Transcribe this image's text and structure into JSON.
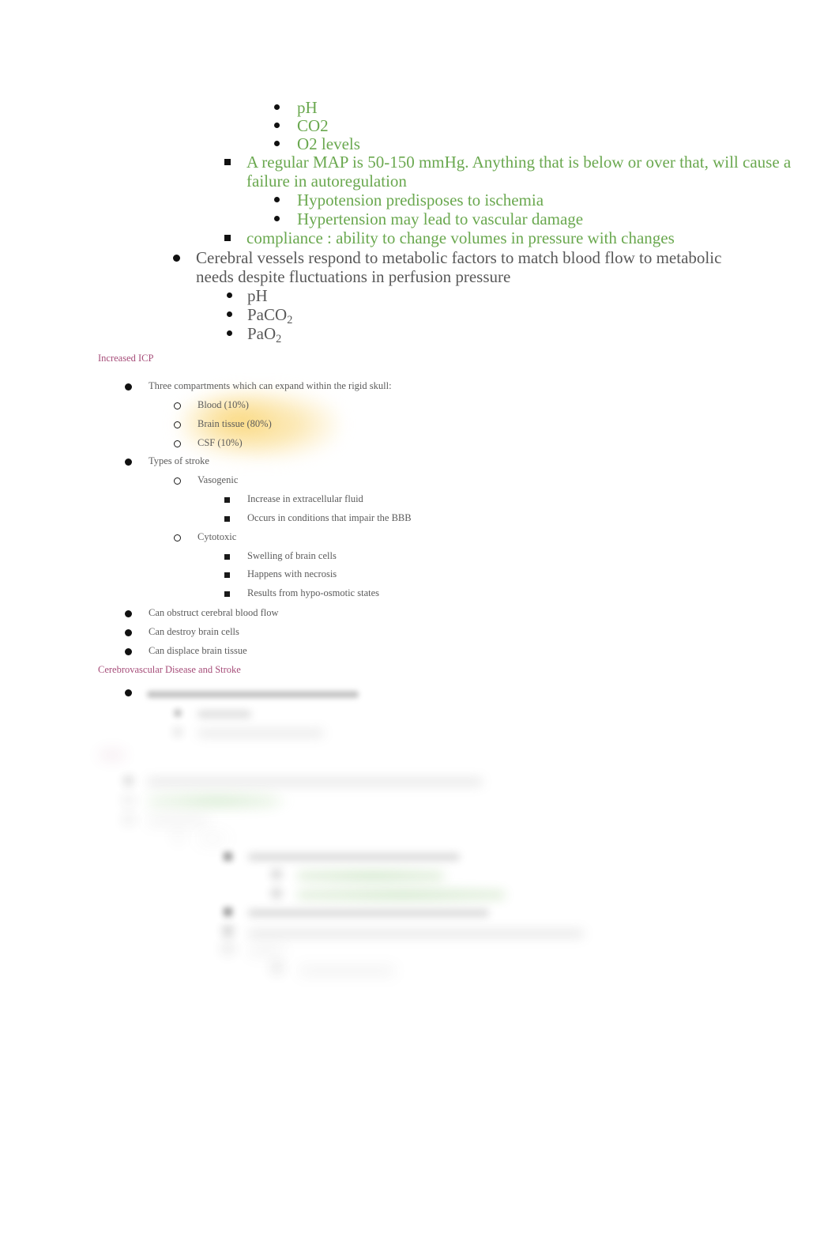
{
  "document": {
    "page_background": "#ffffff",
    "colors": {
      "green_text": "#6aa84f",
      "dark_text": "#595959",
      "heading_magenta": "#a64d79",
      "highlight_yellow": "#fad778",
      "highlight_green": "#96cd8c",
      "bullet_black": "#111111"
    }
  },
  "autoregulation_section": {
    "metabolic_factors": [
      {
        "label": "pH",
        "bullet": "disc-bullet-icon",
        "color": "green"
      },
      {
        "label": "CO2",
        "bullet": "disc-bullet-icon",
        "color": "green"
      },
      {
        "label": "O2 levels",
        "bullet": "disc-bullet-icon",
        "color": "green"
      }
    ],
    "map_statement": {
      "bullet": "square-bullet-icon",
      "color": "green",
      "text": "A regular MAP is 50-150 mmHg. Anything that is below or over that, will cause a failure in autoregulation"
    },
    "map_consequences": [
      {
        "label": "Hypotension predisposes to ischemia",
        "bullet": "disc-bullet-icon",
        "color": "green"
      },
      {
        "label": "Hypertension may lead to vascular damage",
        "bullet": "disc-bullet-icon",
        "color": "green"
      }
    ],
    "compliance": {
      "bullet": "square-bullet-icon",
      "color": "green",
      "text": "compliance : ability to change volumes in pressure with changes"
    },
    "cerebral_vessels": {
      "bullet": "disc-bullet-icon",
      "color": "dark",
      "text": "Cerebral vessels respond to metabolic factors to match blood flow to metabolic needs despite fluctuations in perfusion pressure"
    },
    "cerebral_vessel_factors": [
      {
        "label_html": "pH",
        "bullet": "disc-bullet-icon",
        "color": "dark"
      },
      {
        "label_html": "PaCO<sub>2</sub>",
        "bullet": "disc-bullet-icon",
        "color": "dark"
      },
      {
        "label_html": "PaO<sub>2</sub>",
        "bullet": "disc-bullet-icon",
        "color": "dark"
      }
    ]
  },
  "increased_icp": {
    "heading": "Increased ICP",
    "compartments_intro": {
      "bullet": "disc-bullet-icon",
      "text": "Three compartments which can expand within the rigid skull:"
    },
    "compartments": [
      {
        "label": "Blood (10%)",
        "bullet": "hollow-circle-bullet-icon",
        "highlighted": true
      },
      {
        "label": "Brain tissue (80%)",
        "bullet": "hollow-circle-bullet-icon",
        "highlighted": true
      },
      {
        "label": "CSF (10%)",
        "bullet": "hollow-circle-bullet-icon",
        "highlighted": true
      }
    ],
    "types_of_stroke": {
      "bullet": "disc-bullet-icon",
      "label": "Types of stroke"
    },
    "stroke_types": [
      {
        "name": "Vasogenic",
        "bullet": "hollow-circle-bullet-icon",
        "details": [
          "Increase in extracellular fluid",
          "Occurs in conditions that impair the BBB"
        ]
      },
      {
        "name": "Cytotoxic",
        "bullet": "hollow-circle-bullet-icon",
        "details": [
          "Swelling of brain cells",
          "Happens with necrosis",
          "Results from hypo-osmotic states"
        ]
      }
    ],
    "effects": [
      {
        "label": "Can obstruct cerebral blood flow",
        "bullet": "disc-bullet-icon"
      },
      {
        "label": "Can destroy brain cells",
        "bullet": "disc-bullet-icon"
      },
      {
        "label": "Can displace brain tissue",
        "bullet": "disc-bullet-icon"
      }
    ]
  },
  "cerebrovascular_section": {
    "heading": "Cerebrovascular Disease and Stroke",
    "note": "Remaining content below this heading is out of focus and illegible in the screenshot."
  }
}
